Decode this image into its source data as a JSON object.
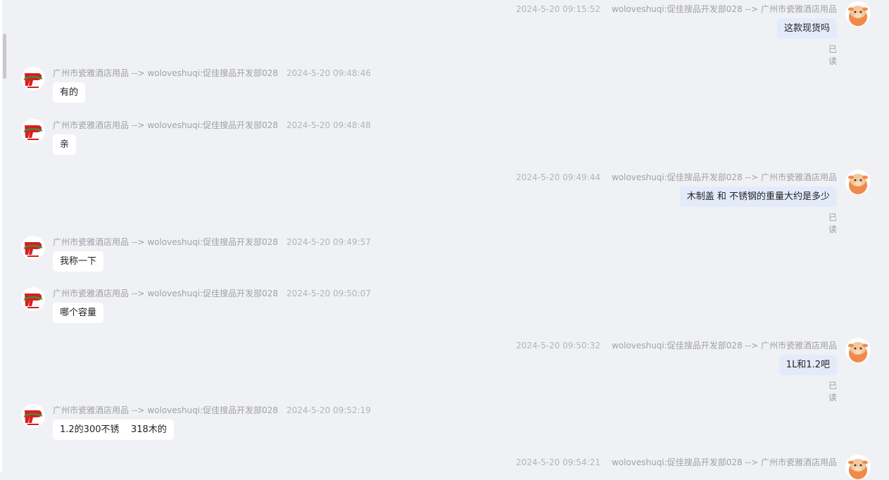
{
  "colors": {
    "background": "#f0f1f5",
    "incoming_bubble": "#ffffff",
    "outgoing_bubble": "#e3ebfb",
    "meta_text": "#a0a0a6"
  },
  "icons": {
    "seller_avatar": "shop-logo-icon",
    "buyer_avatar": "cow-avatar-icon"
  },
  "messages": [
    {
      "direction": "out",
      "time": "2024-5-20 09:15:52",
      "route": "woloveshuqi:促佳搜品开发部028 --> 广州市瓷雅酒店用品",
      "text": "这款现货吗",
      "read": "已读"
    },
    {
      "direction": "in",
      "route": "广州市瓷雅酒店用品 --> woloveshuqi:促佳搜品开发部028",
      "time": "2024-5-20 09:48:46",
      "text": "有的"
    },
    {
      "direction": "in",
      "route": "广州市瓷雅酒店用品 --> woloveshuqi:促佳搜品开发部028",
      "time": "2024-5-20 09:48:48",
      "text": "亲"
    },
    {
      "direction": "out",
      "time": "2024-5-20 09:49:44",
      "route": "woloveshuqi:促佳搜品开发部028 --> 广州市瓷雅酒店用品",
      "text": "木制盖 和 不锈钢的重量大约是多少",
      "read": "已读"
    },
    {
      "direction": "in",
      "route": "广州市瓷雅酒店用品 --> woloveshuqi:促佳搜品开发部028",
      "time": "2024-5-20 09:49:57",
      "text": "我称一下"
    },
    {
      "direction": "in",
      "route": "广州市瓷雅酒店用品 --> woloveshuqi:促佳搜品开发部028",
      "time": "2024-5-20 09:50:07",
      "text": "哪个容量"
    },
    {
      "direction": "out",
      "time": "2024-5-20 09:50:32",
      "route": "woloveshuqi:促佳搜品开发部028 --> 广州市瓷雅酒店用品",
      "text": "1L和1.2吧",
      "read": "已读"
    },
    {
      "direction": "in",
      "route": "广州市瓷雅酒店用品 --> woloveshuqi:促佳搜品开发部028",
      "time": "2024-5-20 09:52:19",
      "text": "1.2的300不锈    318木的"
    },
    {
      "direction": "out",
      "time": "2024-5-20 09:54:21",
      "route": "woloveshuqi:促佳搜品开发部028 --> 广州市瓷雅酒店用品"
    }
  ]
}
